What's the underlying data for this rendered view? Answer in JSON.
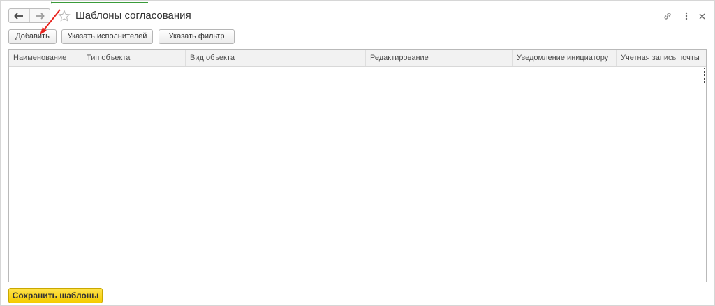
{
  "window": {
    "title": "Шаблоны согласования"
  },
  "navigation": {
    "back_icon": "arrow-left-icon",
    "forward_icon": "arrow-right-icon",
    "favorite_icon": "star-icon"
  },
  "title_icons": {
    "link_icon": "link-icon",
    "more_icon": "more-vertical-icon",
    "close_icon": "close-icon"
  },
  "toolbar": {
    "add_label": "Добавить",
    "assign_performers_label": "Указать исполнителей",
    "set_filter_label": "Указать фильтр"
  },
  "table": {
    "columns": [
      "Наименование",
      "Тип объекта",
      "Вид объекта",
      "Редактирование",
      "Уведомление инициатору",
      "Учетная запись почты"
    ],
    "rows": []
  },
  "footer": {
    "save_label": "Сохранить шаблоны"
  },
  "colors": {
    "tab_accent": "#3a9b3a",
    "primary_button": "#f5cc00",
    "annotation_arrow": "#e8231e"
  }
}
